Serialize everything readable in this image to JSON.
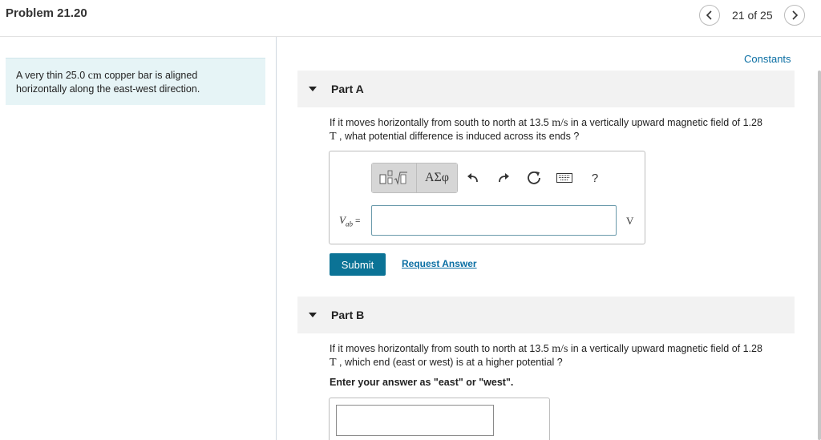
{
  "header": {
    "title": "Problem 21.20",
    "position": "21 of 25"
  },
  "intro": {
    "line1_pre": "A very thin 25.0 ",
    "line1_unit": "cm",
    "line1_post": " copper bar is aligned",
    "line2": "horizontally along the east-west direction."
  },
  "constants_link": "Constants",
  "part_a": {
    "label": "Part A",
    "q_line1_pre": "If it moves horizontally from south to north at 13.5 ",
    "q_line1_unit": "m/s",
    "q_line1_post": " in a vertically upward magnetic field of 1.28",
    "q_line2_unit": "T",
    "q_line2_post": " , what potential difference is induced across its ends ?",
    "toolbar": {
      "greek_label": "ΑΣφ",
      "help_label": "?"
    },
    "variable": "V",
    "variable_sub": "ab",
    "equals": " =",
    "unit": "V",
    "submit_label": "Submit",
    "request_label": "Request Answer"
  },
  "part_b": {
    "label": "Part B",
    "q_line1_pre": "If it moves horizontally from south to north at 13.5 ",
    "q_line1_unit": "m/s",
    "q_line1_post": " in a vertically upward magnetic field of 1.28",
    "q_line2_unit": "T",
    "q_line2_post": " , which end (east or west) is at a higher potential ?",
    "instruction": "Enter your answer as \"east\" or \"west\"."
  },
  "icons": {
    "prev": "chevron-left-icon",
    "next": "chevron-right-icon",
    "templates": "templates-icon",
    "undo": "undo-icon",
    "redo": "redo-icon",
    "reset": "reset-icon",
    "keyboard": "keyboard-icon"
  },
  "colors": {
    "accent": "#0b7396",
    "link": "#0a6ea3",
    "intro_bg": "#e6f4f6",
    "part_header_bg": "#f2f2f2"
  }
}
